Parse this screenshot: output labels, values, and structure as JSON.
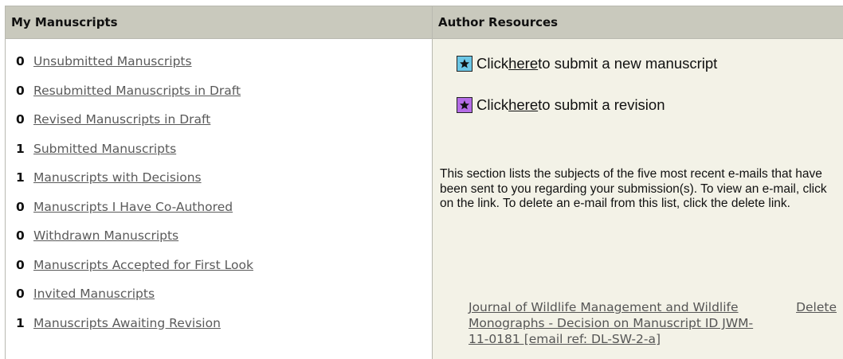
{
  "manuscripts": {
    "title": "My Manuscripts",
    "items": [
      {
        "count": "0",
        "label": "Unsubmitted Manuscripts"
      },
      {
        "count": "0",
        "label": "Resubmitted Manuscripts in Draft"
      },
      {
        "count": "0",
        "label": "Revised Manuscripts in Draft"
      },
      {
        "count": "1",
        "label": "Submitted Manuscripts"
      },
      {
        "count": "1",
        "label": "Manuscripts with Decisions"
      },
      {
        "count": "0",
        "label": "Manuscripts I Have Co-Authored"
      },
      {
        "count": "0",
        "label": "Withdrawn Manuscripts"
      },
      {
        "count": "0",
        "label": "Manuscripts Accepted for First Look"
      },
      {
        "count": "0",
        "label": "Invited Manuscripts"
      },
      {
        "count": "1",
        "label": "Manuscripts Awaiting Revision"
      }
    ]
  },
  "resources": {
    "title": "Author Resources",
    "submit_new": {
      "prefix": "Click ",
      "link": "here",
      "suffix": " to submit a new manuscript",
      "icon": "star-icon",
      "icon_color": "#6cc7e6"
    },
    "submit_revision": {
      "prefix": "Click ",
      "link": "here",
      "suffix": " to submit a revision",
      "icon": "star-icon",
      "icon_color": "#b46ce6"
    },
    "info": "This section lists the subjects of the five most recent e-mails that have been sent to you regarding your submission(s). To view an e-mail, click on the link. To delete an e-mail from this list, click the delete link.",
    "emails": [
      {
        "subject": "Journal of Wildlife Management and Wildlife Monographs - Decision on Manuscript ID JWM-11-0181 [email ref: DL-SW-2-a]",
        "delete_label": "Delete"
      }
    ]
  }
}
